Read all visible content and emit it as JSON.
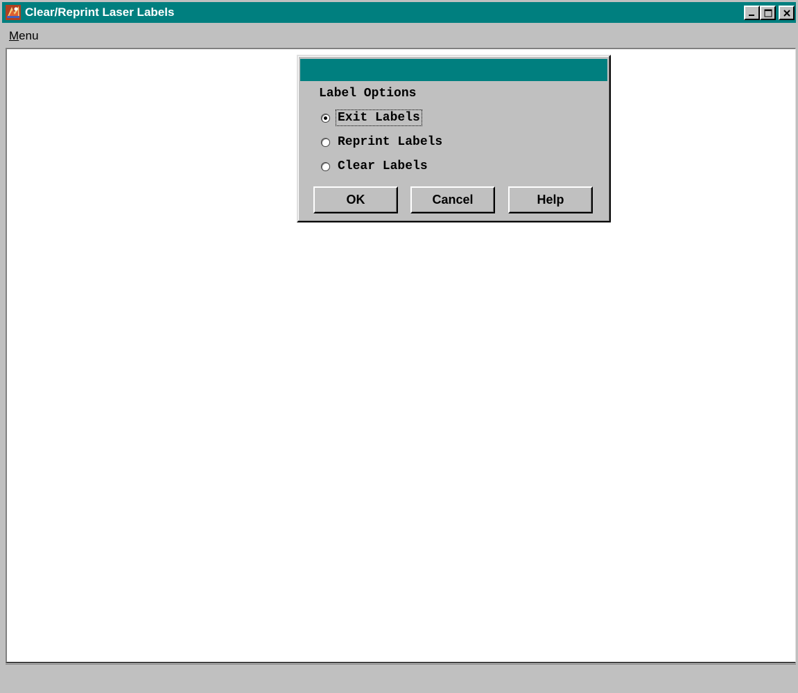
{
  "window": {
    "title": "Clear/Reprint Laser Labels",
    "icon": "app-icon",
    "title_bar_color": "#007f7f",
    "controls": {
      "minimize": "minimize-icon",
      "maximize": "maximize-icon",
      "close": "close-icon"
    }
  },
  "menubar": {
    "items": [
      {
        "label_mnemonic": "M",
        "label_rest": "enu"
      }
    ]
  },
  "dialog": {
    "title": "",
    "group_label": "Label Options",
    "options": [
      {
        "label": "Exit Labels",
        "selected": true
      },
      {
        "label": "Reprint Labels",
        "selected": false
      },
      {
        "label": "Clear Labels",
        "selected": false
      }
    ],
    "buttons": {
      "ok": "OK",
      "cancel": "Cancel",
      "help": "Help"
    }
  },
  "statusbar": {
    "text": ""
  }
}
